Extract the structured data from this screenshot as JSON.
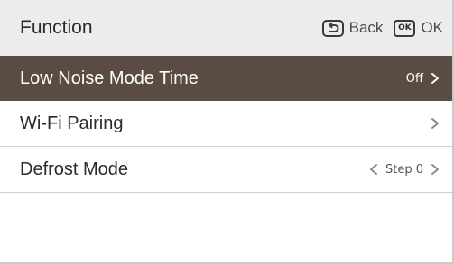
{
  "header": {
    "title": "Function",
    "back_label": "Back",
    "ok_icon_text": "OK",
    "ok_label": "OK"
  },
  "menu": {
    "items": [
      {
        "label": "Low Noise Mode Time",
        "value": "Off",
        "selected": true
      },
      {
        "label": "Wi-Fi Pairing",
        "value": ""
      },
      {
        "label": "Defrost Mode",
        "value": "Step 0"
      }
    ]
  },
  "colors": {
    "header_bg": "#ececec",
    "selected_row_bg": "#5a4c43",
    "divider": "#cfcfcf"
  }
}
